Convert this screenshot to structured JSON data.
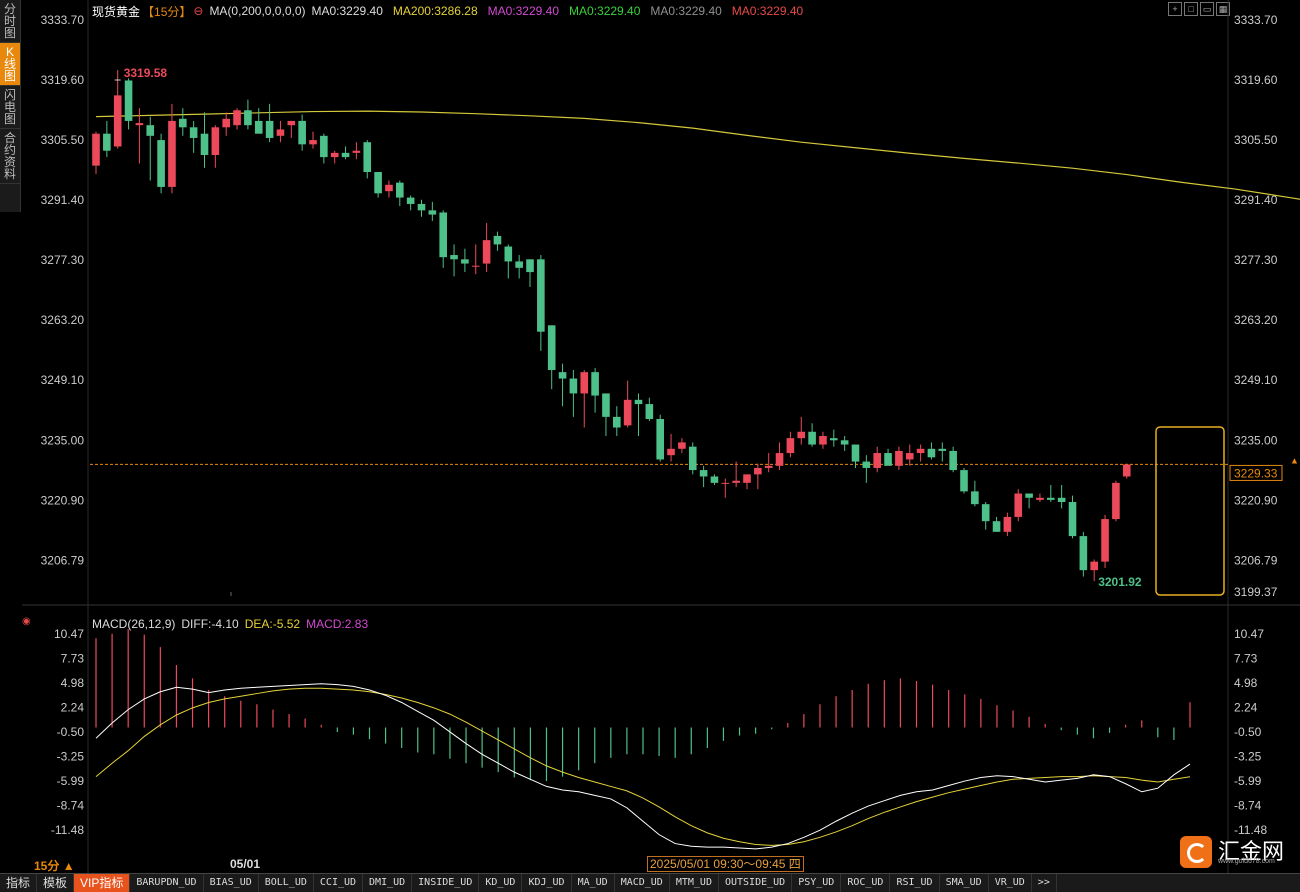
{
  "side_tabs": [
    "分时图",
    "K线图",
    "闪电图",
    "合约资料"
  ],
  "side_tabs_active": 1,
  "header": {
    "instrument": "现货黄金",
    "period_badge": "【15分】",
    "gear": "⊖",
    "ma_params": "MA(0,200,0,0,0,0)",
    "ma_values": [
      {
        "label": "MA0:3229.40",
        "color": "#dddddd"
      },
      {
        "label": "MA200:3286.28",
        "color": "#e6d23a"
      },
      {
        "label": "MA0:3229.40",
        "color": "#d24ad2"
      },
      {
        "label": "MA0:3229.40",
        "color": "#3ad23a"
      },
      {
        "label": "MA0:3229.40",
        "color": "#909090"
      },
      {
        "label": "MA0:3229.40",
        "color": "#e84a4a"
      }
    ]
  },
  "toolbar_icons": [
    "add-icon",
    "window-icon",
    "split-icon",
    "layout-icon"
  ],
  "price_axis": {
    "ticks": [
      "3333.70",
      "3319.60",
      "3305.50",
      "3291.40",
      "3277.30",
      "3263.20",
      "3249.10",
      "3235.00",
      "3220.90",
      "3206.79"
    ],
    "bottom_label": "3199.37",
    "current_price": "3229.33",
    "ylim": [
      3199.37,
      3333.7
    ]
  },
  "annotations": {
    "high_label": "3319.58",
    "low_label": "3201.92"
  },
  "macd_header": {
    "title": "MACD(26,12,9)",
    "diff": "DIFF:-4.10",
    "dea": "DEA:-5.52",
    "macd": "MACD:2.83"
  },
  "macd_axis": {
    "ticks": [
      "10.47",
      "7.73",
      "4.98",
      "2.24",
      "-0.50",
      "-3.25",
      "-5.99",
      "-8.74",
      "-11.48"
    ],
    "ylim": [
      -12.5,
      11.0
    ]
  },
  "x_axis": {
    "period": "15分",
    "date_label": "05/01",
    "crosshair_time": "2025/05/01 09:30～09:45 四"
  },
  "bottom_bar": [
    "指标",
    "模板",
    "VIP指标",
    "BARUPDN_UD",
    "BIAS_UD",
    "BOLL_UD",
    "CCI_UD",
    "DMI_UD",
    "INSIDE_UD",
    "KD_UD",
    "KDJ_UD",
    "MA_UD",
    "MACD_UD",
    "MTM_UD",
    "OUTSIDE_UD",
    "PSY_UD",
    "ROC_UD",
    "RSI_UD",
    "SMA_UD",
    "VR_UD",
    ">>"
  ],
  "logo": {
    "name": "汇金网",
    "url": "www.gold678.com"
  },
  "colors": {
    "up": "#ec4a5a",
    "down": "#4ec08a",
    "ma200": "#d4c83a",
    "diff": "#ffffff",
    "dea": "#e6d23a"
  },
  "chart_data": {
    "type": "candlestick",
    "ohlc": [
      [
        3299.5,
        3307.5,
        3297.5,
        3307.0
      ],
      [
        3307.0,
        3310.0,
        3301.5,
        3303.0
      ],
      [
        3304.0,
        3322.0,
        3303.5,
        3316.0
      ],
      [
        3319.5,
        3320.0,
        3308.0,
        3310.0
      ],
      [
        3309.0,
        3313.0,
        3300.0,
        3309.5
      ],
      [
        3309.0,
        3311.0,
        3296.0,
        3306.5
      ],
      [
        3305.5,
        3307.0,
        3293.0,
        3294.5
      ],
      [
        3294.5,
        3314.0,
        3293.0,
        3310.0
      ],
      [
        3310.5,
        3313.0,
        3306.5,
        3308.5
      ],
      [
        3308.5,
        3310.0,
        3302.5,
        3306.0
      ],
      [
        3307.0,
        3312.0,
        3299.0,
        3302.0
      ],
      [
        3302.0,
        3309.0,
        3299.0,
        3308.5
      ],
      [
        3308.5,
        3312.0,
        3306.5,
        3310.5
      ],
      [
        3309.0,
        3313.0,
        3308.0,
        3312.5
      ],
      [
        3312.5,
        3315.0,
        3308.0,
        3309.0
      ],
      [
        3310.0,
        3313.0,
        3307.0,
        3307.0
      ],
      [
        3310.0,
        3314.0,
        3305.0,
        3306.0
      ],
      [
        3306.5,
        3310.0,
        3305.0,
        3308.0
      ],
      [
        3309.0,
        3310.0,
        3306.0,
        3310.0
      ],
      [
        3310.0,
        3311.5,
        3303.0,
        3304.5
      ],
      [
        3304.5,
        3307.5,
        3303.5,
        3305.5
      ],
      [
        3306.5,
        3307.0,
        3300.0,
        3301.5
      ],
      [
        3301.5,
        3303.0,
        3300.0,
        3302.5
      ],
      [
        3302.5,
        3304.0,
        3301.0,
        3301.5
      ],
      [
        3302.5,
        3305.0,
        3301.0,
        3303.0
      ],
      [
        3305.0,
        3305.5,
        3296.5,
        3298.0
      ],
      [
        3298.0,
        3298.0,
        3292.0,
        3293.0
      ],
      [
        3293.5,
        3296.0,
        3292.0,
        3295.0
      ],
      [
        3295.5,
        3296.0,
        3290.0,
        3292.0
      ],
      [
        3292.0,
        3292.5,
        3289.0,
        3290.5
      ],
      [
        3290.5,
        3291.5,
        3287.5,
        3289.0
      ],
      [
        3289.0,
        3291.0,
        3286.5,
        3288.0
      ],
      [
        3288.5,
        3289.0,
        3275.5,
        3278.0
      ],
      [
        3278.5,
        3281.0,
        3273.5,
        3277.5
      ],
      [
        3277.5,
        3280.0,
        3274.5,
        3276.5
      ],
      [
        3276.0,
        3281.0,
        3274.0,
        3276.0
      ],
      [
        3276.5,
        3286.0,
        3274.5,
        3282.0
      ],
      [
        3283.0,
        3284.0,
        3279.5,
        3281.0
      ],
      [
        3280.5,
        3281.0,
        3273.0,
        3277.0
      ],
      [
        3277.0,
        3278.5,
        3273.0,
        3275.5
      ],
      [
        3277.5,
        3277.5,
        3271.0,
        3274.5
      ],
      [
        3277.5,
        3278.5,
        3256.0,
        3260.5
      ],
      [
        3262.0,
        3262.0,
        3247.0,
        3251.5
      ],
      [
        3251.0,
        3253.0,
        3243.0,
        3249.5
      ],
      [
        3249.5,
        3251.5,
        3240.5,
        3246.0
      ],
      [
        3246.0,
        3251.5,
        3238.0,
        3251.0
      ],
      [
        3251.0,
        3252.0,
        3241.5,
        3245.5
      ],
      [
        3246.0,
        3246.0,
        3236.0,
        3240.5
      ],
      [
        3240.5,
        3243.0,
        3236.0,
        3238.0
      ],
      [
        3238.5,
        3249.0,
        3238.0,
        3244.5
      ],
      [
        3244.5,
        3246.0,
        3236.0,
        3243.5
      ],
      [
        3243.5,
        3245.0,
        3239.5,
        3240.0
      ],
      [
        3240.0,
        3241.0,
        3230.0,
        3230.5
      ],
      [
        3231.5,
        3236.5,
        3230.0,
        3233.0
      ],
      [
        3233.0,
        3235.5,
        3232.0,
        3234.5
      ],
      [
        3233.5,
        3234.5,
        3227.0,
        3228.0
      ],
      [
        3228.0,
        3229.0,
        3224.0,
        3226.5
      ],
      [
        3226.5,
        3227.0,
        3224.5,
        3225.0
      ],
      [
        3225.0,
        3226.0,
        3221.5,
        3225.0
      ],
      [
        3225.0,
        3230.0,
        3224.0,
        3225.5
      ],
      [
        3225.0,
        3226.5,
        3223.5,
        3227.0
      ],
      [
        3227.0,
        3229.5,
        3223.5,
        3228.5
      ],
      [
        3228.5,
        3232.0,
        3227.5,
        3229.0
      ],
      [
        3229.0,
        3234.5,
        3228.0,
        3232.0
      ],
      [
        3232.0,
        3237.0,
        3231.0,
        3235.5
      ],
      [
        3235.5,
        3240.5,
        3234.0,
        3237.0
      ],
      [
        3237.0,
        3239.0,
        3233.5,
        3234.0
      ],
      [
        3234.0,
        3237.0,
        3233.0,
        3236.0
      ],
      [
        3235.5,
        3237.5,
        3233.5,
        3235.0
      ],
      [
        3235.0,
        3236.0,
        3232.5,
        3234.0
      ],
      [
        3234.0,
        3234.0,
        3228.5,
        3230.0
      ],
      [
        3230.0,
        3231.5,
        3225.0,
        3228.5
      ],
      [
        3228.5,
        3233.5,
        3227.5,
        3232.0
      ],
      [
        3232.0,
        3233.0,
        3229.5,
        3229.0
      ],
      [
        3229.0,
        3233.5,
        3228.0,
        3232.5
      ],
      [
        3230.5,
        3234.0,
        3229.0,
        3232.0
      ],
      [
        3232.0,
        3234.0,
        3230.0,
        3233.0
      ],
      [
        3233.0,
        3234.5,
        3230.5,
        3231.0
      ],
      [
        3233.0,
        3234.5,
        3230.0,
        3232.5
      ],
      [
        3232.5,
        3233.5,
        3227.5,
        3228.0
      ],
      [
        3228.0,
        3228.5,
        3222.5,
        3223.0
      ],
      [
        3223.0,
        3225.5,
        3219.5,
        3220.0
      ],
      [
        3220.0,
        3220.5,
        3214.0,
        3216.0
      ],
      [
        3216.0,
        3217.0,
        3213.5,
        3213.5
      ],
      [
        3213.5,
        3218.0,
        3212.5,
        3217.0
      ],
      [
        3217.0,
        3223.5,
        3216.0,
        3222.5
      ],
      [
        3222.5,
        3222.5,
        3219.0,
        3221.5
      ],
      [
        3221.0,
        3222.5,
        3220.5,
        3221.5
      ],
      [
        3221.5,
        3224.5,
        3220.5,
        3221.0
      ],
      [
        3221.5,
        3224.5,
        3219.0,
        3220.5
      ],
      [
        3220.5,
        3222.0,
        3212.0,
        3212.5
      ],
      [
        3212.5,
        3213.5,
        3203.0,
        3204.5
      ],
      [
        3204.5,
        3207.0,
        3201.92,
        3206.5
      ],
      [
        3206.5,
        3217.5,
        3205.0,
        3216.5
      ],
      [
        3216.5,
        3225.5,
        3216.0,
        3225.0
      ],
      [
        3226.5,
        3229.5,
        3226.0,
        3229.33
      ]
    ],
    "ma200": [
      [
        0,
        3311.0
      ],
      [
        5,
        3311.3
      ],
      [
        10,
        3311.6
      ],
      [
        15,
        3311.9
      ],
      [
        20,
        3312.2
      ],
      [
        25,
        3312.3
      ],
      [
        30,
        3312.1
      ],
      [
        35,
        3311.7
      ],
      [
        40,
        3311.2
      ],
      [
        45,
        3310.6
      ],
      [
        50,
        3309.6
      ],
      [
        55,
        3308.3
      ],
      [
        60,
        3306.6
      ],
      [
        65,
        3305.0
      ],
      [
        70,
        3303.7
      ],
      [
        75,
        3302.4
      ],
      [
        80,
        3301.2
      ],
      [
        85,
        3300.1
      ],
      [
        90,
        3298.9
      ],
      [
        95,
        3297.4
      ],
      [
        100,
        3295.6
      ],
      [
        105,
        3294.0
      ],
      [
        110,
        3292.0
      ],
      [
        115,
        3290.0
      ],
      [
        120,
        3288.8
      ],
      [
        125,
        3287.9
      ],
      [
        130,
        3286.28
      ]
    ],
    "macd": {
      "diff": [
        -1.2,
        0.5,
        2.0,
        3.2,
        4.0,
        4.5,
        4.3,
        3.9,
        4.2,
        4.4,
        4.5,
        4.6,
        4.7,
        4.8,
        4.9,
        4.8,
        4.6,
        4.2,
        3.6,
        2.8,
        1.8,
        0.8,
        -0.5,
        -1.8,
        -3.0,
        -4.0,
        -5.0,
        -5.8,
        -6.6,
        -7.0,
        -7.2,
        -7.6,
        -8.0,
        -9.0,
        -10.5,
        -12.0,
        -13.0,
        -13.3,
        -13.4,
        -13.4,
        -13.5,
        -13.6,
        -13.4,
        -13.0,
        -12.3,
        -11.5,
        -10.5,
        -9.6,
        -8.8,
        -8.2,
        -7.6,
        -7.2,
        -7.0,
        -6.5,
        -6.0,
        -5.6,
        -5.4,
        -5.5,
        -5.8,
        -6.1,
        -5.9,
        -5.7,
        -5.3,
        -5.5,
        -6.3,
        -7.2,
        -6.8,
        -5.3,
        -4.1
      ],
      "dea": [
        -5.5,
        -4.0,
        -2.6,
        -1.0,
        0.3,
        1.4,
        2.2,
        2.8,
        3.2,
        3.5,
        3.8,
        4.1,
        4.3,
        4.4,
        4.4,
        4.3,
        4.2,
        4.0,
        3.7,
        3.3,
        2.8,
        2.2,
        1.5,
        0.6,
        -0.4,
        -1.4,
        -2.4,
        -3.4,
        -4.3,
        -5.0,
        -5.6,
        -6.1,
        -6.6,
        -7.1,
        -7.9,
        -8.9,
        -10.0,
        -11.0,
        -11.8,
        -12.4,
        -12.8,
        -13.1,
        -13.2,
        -13.1,
        -12.8,
        -12.3,
        -11.7,
        -11.0,
        -10.2,
        -9.5,
        -8.9,
        -8.3,
        -7.8,
        -7.3,
        -6.9,
        -6.5,
        -6.1,
        -5.8,
        -5.7,
        -5.6,
        -5.5,
        -5.5,
        -5.4,
        -5.5,
        -5.6,
        -5.9,
        -6.1,
        -5.8,
        -5.52
      ],
      "hist": [
        10.0,
        10.5,
        11.0,
        10.4,
        9.0,
        7.0,
        5.5,
        4.2,
        3.5,
        3.0,
        2.6,
        2.0,
        1.5,
        1.0,
        0.3,
        -0.5,
        -0.8,
        -1.3,
        -1.8,
        -2.3,
        -2.8,
        -3.0,
        -3.5,
        -4.0,
        -4.5,
        -5.0,
        -5.6,
        -5.9,
        -6.0,
        -5.5,
        -4.8,
        -4.0,
        -3.4,
        -3.0,
        -3.0,
        -3.2,
        -3.4,
        -3.0,
        -2.3,
        -1.5,
        -0.9,
        -0.7,
        -0.2,
        0.5,
        1.5,
        2.6,
        3.5,
        4.2,
        4.9,
        5.3,
        5.5,
        5.2,
        4.8,
        4.2,
        3.7,
        3.2,
        2.5,
        1.9,
        1.2,
        0.4,
        -0.3,
        -0.8,
        -1.2,
        -0.6,
        0.3,
        0.8,
        -1.1,
        -1.4,
        2.83
      ]
    }
  }
}
